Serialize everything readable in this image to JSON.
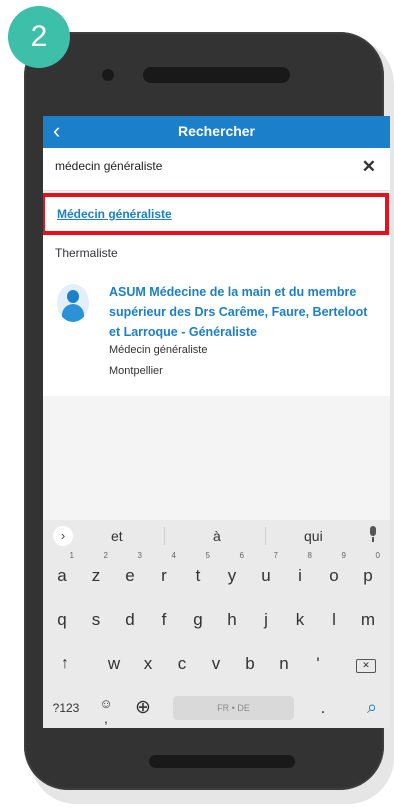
{
  "step_badge": "2",
  "header": {
    "title": "Rechercher",
    "back_glyph": "‹"
  },
  "search": {
    "value": "médecin généraliste",
    "clear_glyph": "✕"
  },
  "suggestions": [
    {
      "label": "Médecin généraliste",
      "highlighted": true
    },
    {
      "label": "Thermaliste",
      "highlighted": false
    }
  ],
  "result": {
    "title": "ASUM Médecine de la main et du membre supérieur des Drs Carême, Faure, Berteloot et Larroque - Généraliste",
    "specialty": "Médecin généraliste",
    "city": "Montpellier"
  },
  "keyboard": {
    "expand_glyph": "›",
    "suggestions": [
      "et",
      "à",
      "qui"
    ],
    "row1": [
      {
        "k": "a",
        "sup": "1"
      },
      {
        "k": "z",
        "sup": "2"
      },
      {
        "k": "e",
        "sup": "3"
      },
      {
        "k": "r",
        "sup": "4"
      },
      {
        "k": "t",
        "sup": "5"
      },
      {
        "k": "y",
        "sup": "6"
      },
      {
        "k": "u",
        "sup": "7"
      },
      {
        "k": "i",
        "sup": "8"
      },
      {
        "k": "o",
        "sup": "9"
      },
      {
        "k": "p",
        "sup": "0"
      }
    ],
    "row2": [
      "q",
      "s",
      "d",
      "f",
      "g",
      "h",
      "j",
      "k",
      "l",
      "m"
    ],
    "row3": [
      "w",
      "x",
      "c",
      "v",
      "b",
      "n",
      "'"
    ],
    "shift_glyph": "↑",
    "backspace_glyph": "✕",
    "sym_label": "?123",
    "emoji_glyph": "☺",
    "comma": ",",
    "globe_glyph": "⊕",
    "space_label": "FR • DE",
    "period": ".",
    "search_glyph": "⌕"
  },
  "colors": {
    "accent": "#1b7fc9",
    "highlight_border": "#e8111b",
    "badge": "#3dbfa9"
  }
}
